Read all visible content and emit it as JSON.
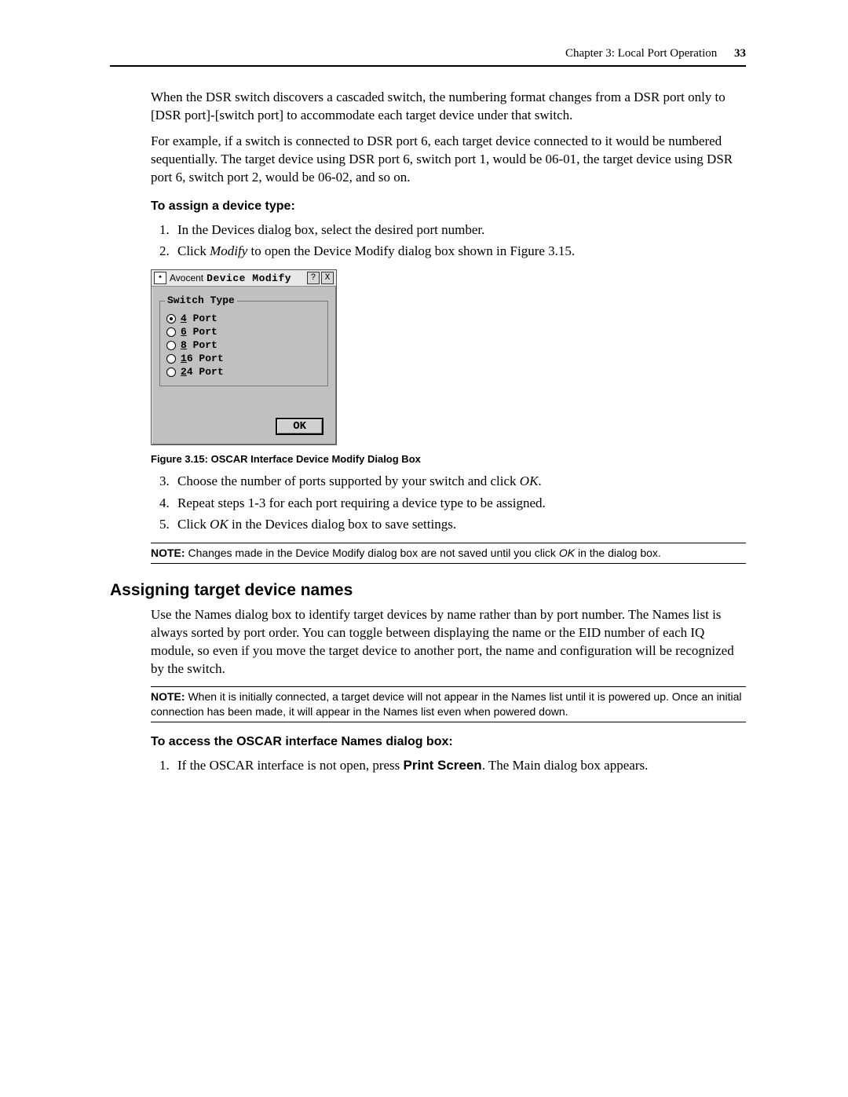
{
  "header": {
    "chapter": "Chapter 3: Local Port Operation",
    "page": "33"
  },
  "intro": {
    "p1": "When the DSR switch discovers a cascaded switch, the numbering format changes from a DSR port only to [DSR port]-[switch port] to accommodate each target device under that switch.",
    "p2": "For example, if a switch is connected to DSR port 6, each target device connected to it would be numbered sequentially. The target device using DSR port 6, switch port 1, would be 06-01, the target device using DSR port 6, switch port 2, would be 06-02, and so on."
  },
  "assign": {
    "heading": "To assign a device type:",
    "steps12": {
      "s1": "In the Devices dialog box, select the desired port number.",
      "s2_a": "Click ",
      "s2_b": "Modify",
      "s2_c": " to open the Device Modify dialog box shown in Figure 3.15."
    },
    "steps345": {
      "s3_a": "Choose the number of ports supported by your switch and click ",
      "s3_b": "OK",
      "s3_c": ".",
      "s4": "Repeat steps 1-3 for each port requiring a device type to be assigned.",
      "s5_a": "Click ",
      "s5_b": "OK",
      "s5_c": " in the Devices dialog box to save settings."
    }
  },
  "dialog": {
    "brand": "Avocent",
    "title": "Device Modify",
    "legend": "Switch Type",
    "opts": {
      "o1a": "4",
      "o1b": " Port",
      "o2a": "6",
      "o2b": " Port",
      "o3a": "8",
      "o3b": " Port",
      "o4a": "1",
      "o4b": "6 Port",
      "o5a": "2",
      "o5b": "4 Port"
    },
    "ok": "OK",
    "help": "?",
    "close": "X"
  },
  "caption": "Figure 3.15: OSCAR Interface Device Modify Dialog Box",
  "note1": {
    "label": "NOTE:",
    "a": " Changes made in the Device Modify dialog box are not saved until you click ",
    "b": "OK",
    "c": " in the dialog box."
  },
  "names": {
    "heading": "Assigning target device names",
    "p": "Use the Names dialog box to identify target devices by name rather than by port number. The Names list is always sorted by port order. You can toggle between displaying the name or the EID number of each IQ module, so even if you move the target device to another port, the name and configuration will be recognized by the switch."
  },
  "note2": {
    "label": "NOTE:",
    "text": " When it is initially connected, a target device will not appear in the Names list until it is powered up. Once an initial connection has been made, it will appear in the Names list even when powered down."
  },
  "access": {
    "heading": "To access the OSCAR interface Names dialog box:",
    "s1_a": "If the OSCAR interface is not open, press ",
    "s1_b": "Print Screen",
    "s1_c": ". The Main dialog box appears."
  }
}
